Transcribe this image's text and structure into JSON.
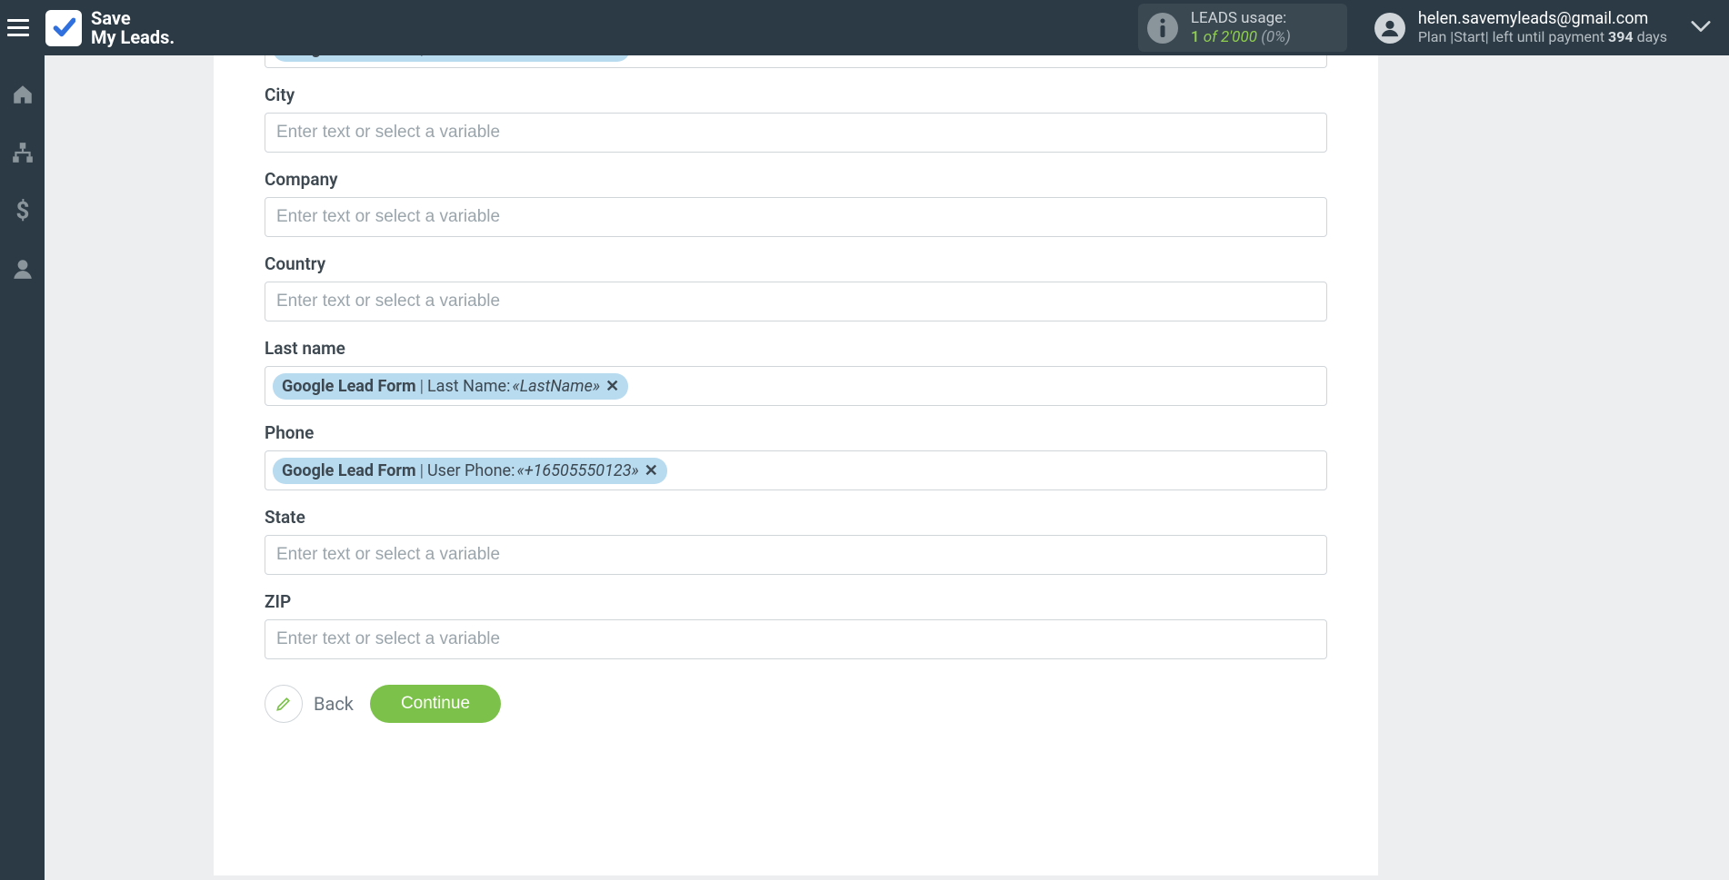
{
  "header": {
    "logo_line1": "Save",
    "logo_line2": "My Leads.",
    "leads_usage_label": "LEADS usage:",
    "leads_count": "1",
    "leads_of": "of",
    "leads_total": "2'000",
    "leads_pct": "(0%)",
    "user_email": "helen.savemyleads@gmail.com",
    "plan_prefix": "Plan |Start| left until payment ",
    "plan_days": "394",
    "plan_suffix": " days"
  },
  "form": {
    "input_placeholder": "Enter text or select a variable",
    "chip_source": "Google Lead Form",
    "first_chip": {
      "field": "First Name:",
      "value": "«FirstName»"
    },
    "fields": {
      "city": {
        "label": "City"
      },
      "company": {
        "label": "Company"
      },
      "country": {
        "label": "Country"
      },
      "lastname": {
        "label": "Last name",
        "chip": {
          "field": "Last Name:",
          "value": "«LastName»"
        }
      },
      "phone": {
        "label": "Phone",
        "chip": {
          "field": "User Phone:",
          "value": "«+16505550123»"
        }
      },
      "state": {
        "label": "State"
      },
      "zip": {
        "label": "ZIP"
      }
    }
  },
  "actions": {
    "back": "Back",
    "continue": "Continue"
  }
}
